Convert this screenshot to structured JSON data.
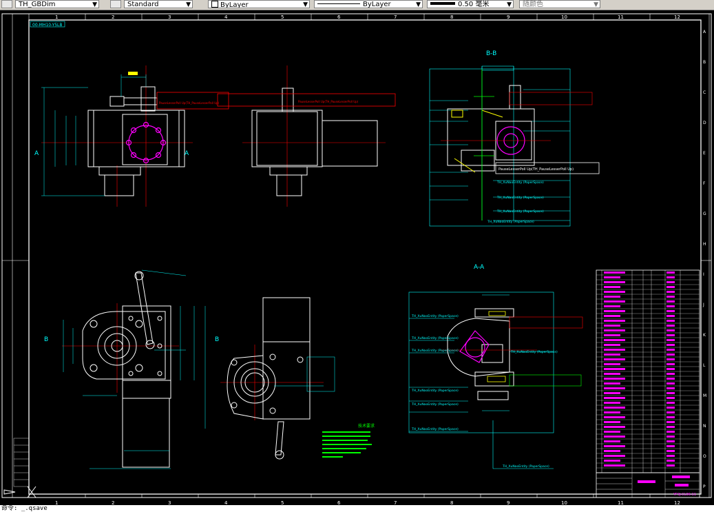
{
  "toolbar": {
    "dimstyle": "TH_GBDim",
    "textstyle": "Standard",
    "layer": "ByLayer",
    "linetype": "ByLayer",
    "lineweight": "0.50 毫米",
    "color": "随颜色"
  },
  "frame": {
    "top_numbers": [
      "1",
      "2",
      "3",
      "4",
      "5",
      "6",
      "7",
      "8",
      "9",
      "10",
      "11",
      "12"
    ],
    "side_letters": [
      "A",
      "B",
      "C",
      "D",
      "E",
      "F",
      "G",
      "H",
      "I",
      "J",
      "K",
      "L",
      "M",
      "N",
      "O",
      "P"
    ],
    "drawing_code": "00-MH10-Y5LB"
  },
  "views": {
    "section_bb": "B-B",
    "section_aa": "A-A",
    "label_a": "A",
    "label_b": "B"
  },
  "annotations": {
    "paper_space": "TH_XuNaoEntity (PaperSpace)",
    "paper_space_2": "TH_XuNaoEntity (PaperSpace)",
    "paper_space_3": "TH_XuNaoEntity (PaperSpace)",
    "paper_space_4": "TH_XuNaoEntity (PaperSpace)",
    "paper_space_5": "TH_XuNaoEntity (PaperSpace)",
    "paper_space_6": "TH_XuNaoEntity (PaperSpace)",
    "paper_space_7": "TH_XuNaoEntity (PaperSpace)",
    "paper_space_8": "TH_XuNaoEntity (PaperSpace)",
    "pause_label": "PauseLesserPoll Up(TH_PauseLesserPoll Up)"
  },
  "notes": {
    "heading": "技术要求"
  },
  "title_block": {
    "drawing_no": "YF3J-CL06-11"
  },
  "cmdline": {
    "text": "命令: _.qsave"
  }
}
